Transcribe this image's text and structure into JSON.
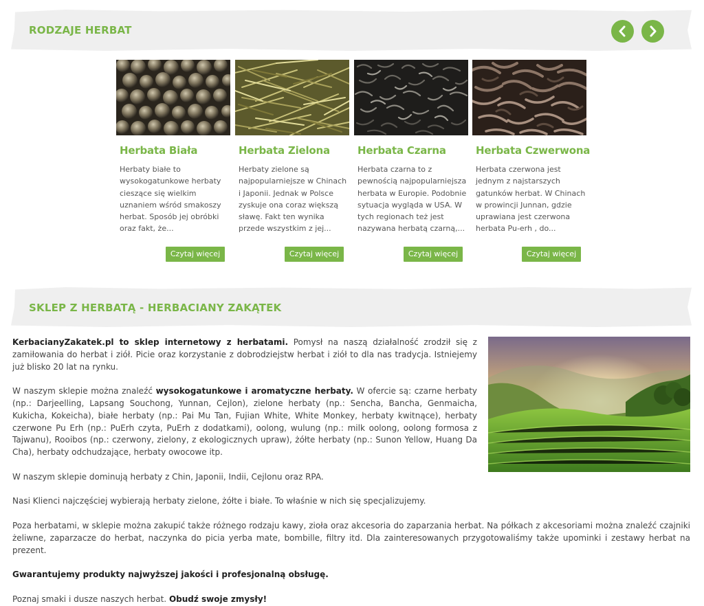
{
  "section1": {
    "title": "RODZAJE HERBAT",
    "prev_icon": "chevron-left-icon",
    "next_icon": "chevron-right-icon"
  },
  "cards": [
    {
      "title": "Herbata Biała",
      "text": "Herbaty białe to wysokogatunkowe herbaty cieszące się wielkim uznaniem wśród smakoszy herbat. Sposób jej obróbki oraz fakt, że...",
      "button": "Czytaj więcej"
    },
    {
      "title": "Herbata Zielona",
      "text": "Herbaty zielone są najpopularniejsze w Chinach i Japonii. Jednak w Polsce zyskuje ona coraz większą sławę. Fakt ten wynika przede wszystkim z jej...",
      "button": "Czytaj więcej"
    },
    {
      "title": "Herbata Czarna",
      "text": "Herbata czarna to z pewnością najpopularniejsza herbata w Europie. Podobnie sytuacja wygląda w USA. W tych regionach też jest nazywana herbatą czarną,...",
      "button": "Czytaj więcej"
    },
    {
      "title": "Herbata Czwerwona",
      "text": "Herbata czerwona jest jednym z najstarszych gatunków herbat. W Chinach w prowincji Junnan, gdzie uprawiana jest czerwona herbata Pu-erh , do...",
      "button": "Czytaj więcej"
    }
  ],
  "section2": {
    "title": "SKLEP Z HERBATĄ - HERBACIANY ZAKĄTEK"
  },
  "article": {
    "p1_strong": "KerbacianyZakatek.pl to sklep internetowy z herbatami.",
    "p1_rest": " Pomysł na naszą działalność zrodził się z zamiłowania do herbat i ziół. Picie oraz korzystanie z dobrodziejstw herbat i ziół to dla nas tradycja. Istniejemy już blisko 20 lat na rynku.",
    "p2_a": "W naszym sklepie można znaleźć ",
    "p2_strong": "wysokogatunkowe i aromatyczne herbaty.",
    "p2_rest": " W ofercie są: czarne herbaty (np.: Darjeelling, Lapsang Souchong, Yunnan, Cejlon), zielone herbaty (np.: Sencha, Bancha, Genmaicha, Kukicha, Kokeicha), białe herbaty (np.: Pai Mu Tan, Fujian White, White Monkey, herbaty kwitnące), herbaty czerwone Pu Erh (np.: PuErh czyta, PuErh z dodatkami), oolong, wulung (np.: milk oolong, oolong formosa z Tajwanu), Rooibos (np.: czerwony, zielony, z ekologicznych upraw), żółte herbaty (np.: Sunon Yellow, Huang Da Cha), herbaty odchudzające, herbaty owocowe itp.",
    "p3": "W naszym sklepie dominują herbaty z Chin, Japonii, Indii, Cejlonu oraz RPA.",
    "p4": "Nasi Klienci najczęściej wybierają herbaty zielone, żółte i białe. To właśnie w nich się specjalizujemy.",
    "p5": "Poza herbatami, w sklepie można zakupić także różnego rodzaju kawy, zioła oraz akcesoria do zaparzania herbat. Na półkach z akcesoriami można znaleźć czajniki żeliwne, zaparzacze do herbat, naczynka do picia yerba mate, bombille, filtry itd. Dla zainteresowanych przygotowaliśmy także upominki i zestawy herbat na prezent.",
    "p6_strong": "Gwarantujemy produkty najwyższej jakości i profesjonalną obsługę.",
    "p7_a": "Poznaj smaki i dusze naszych herbat. ",
    "p7_strong": "Obudź swoje zmysły!"
  },
  "colors": {
    "accent": "#7ab648",
    "band": "#efefef",
    "text": "#444444"
  }
}
